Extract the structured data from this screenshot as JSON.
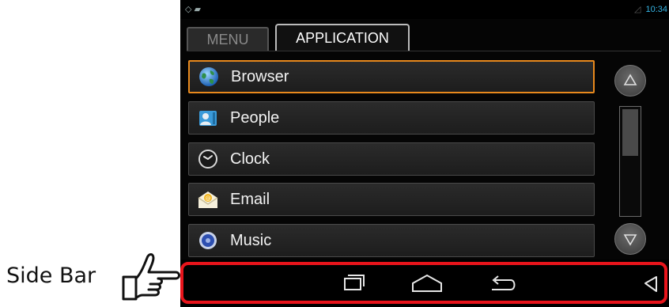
{
  "annotation": {
    "label": "Side Bar"
  },
  "status_bar": {
    "left_icons": "◇ ▰",
    "time": "10:34"
  },
  "tabs": [
    {
      "label": "MENU",
      "active": false
    },
    {
      "label": "APPLICATION",
      "active": true
    }
  ],
  "apps": [
    {
      "label": "Browser",
      "icon": "globe-icon",
      "focused": true
    },
    {
      "label": "People",
      "icon": "contacts-icon",
      "focused": false
    },
    {
      "label": "Clock",
      "icon": "clock-icon",
      "focused": false
    },
    {
      "label": "Email",
      "icon": "envelope-icon",
      "focused": false
    },
    {
      "label": "Music",
      "icon": "music-disc-icon",
      "focused": false
    }
  ],
  "scroll": {
    "thumb_fraction": 0.45
  },
  "nav_bar": {
    "buttons": [
      "recent-apps-icon",
      "home-icon",
      "back-icon",
      "side-bar-toggle-icon"
    ]
  },
  "colors": {
    "focus": "#e8891d",
    "highlight": "#e8141b",
    "status_accent": "#35b5e5"
  }
}
